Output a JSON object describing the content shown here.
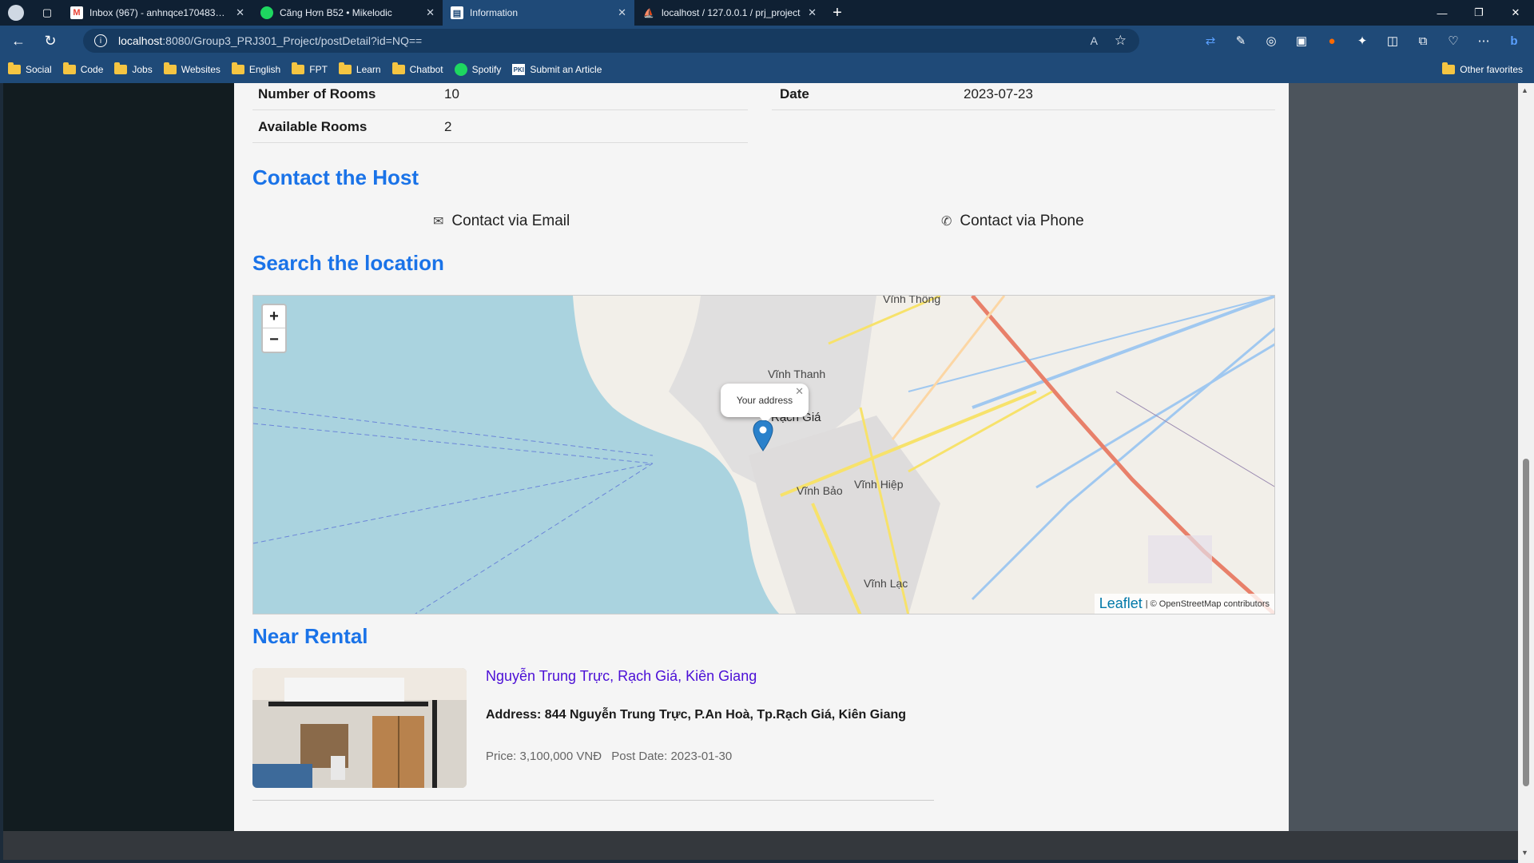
{
  "browser": {
    "tabs": [
      {
        "title": "Inbox (967) - anhnqce170483@fpt.edu.vn",
        "icon": "gmail-icon",
        "active": false
      },
      {
        "title": "Căng Hơn B52 • Mikelodic",
        "icon": "spotify-icon",
        "active": false
      },
      {
        "title": "Information",
        "icon": "page-icon",
        "active": true
      },
      {
        "title": "localhost / 127.0.0.1 / prj_project",
        "icon": "phpmyadmin-icon",
        "active": false
      }
    ],
    "url_host": "localhost",
    "url_path": ":8080/Group3_PRJ301_Project/postDetail?id=NQ==",
    "bookmarks": [
      "Social",
      "Code",
      "Jobs",
      "Websites",
      "English",
      "FPT",
      "Learn",
      "Chatbot",
      "Spotify",
      "Submit an Article"
    ],
    "other_favorites": "Other favorites"
  },
  "details": {
    "number_of_rooms_label": "Number of Rooms",
    "number_of_rooms": "10",
    "available_rooms_label": "Available Rooms",
    "available_rooms": "2",
    "date_label": "Date",
    "date": "2023-07-23"
  },
  "contact": {
    "heading": "Contact the Host",
    "email_label": "Contact via Email",
    "phone_label": "Contact via Phone"
  },
  "location": {
    "heading": "Search the location",
    "zoom_in": "+",
    "zoom_out": "−",
    "popup_text": "Your address",
    "attribution_leaflet": "Leaflet",
    "attribution_osm": "| © OpenStreetMap contributors",
    "labels": [
      "Rạch Giá",
      "Vĩnh Thanh",
      "Vĩnh Bảo",
      "Vĩnh Hiệp",
      "Vĩnh Lạc",
      "Vĩnh Thông"
    ]
  },
  "near_rental": {
    "heading": "Near Rental",
    "item": {
      "title": "Nguyễn Trung Trực, Rạch Giá, Kiên Giang",
      "address": "Address: 844 Nguyễn Trung Trực, P.An Hoà, Tp.Rạch Giá, Kiên Giang",
      "price": "Price: 3,100,000 VNĐ",
      "post_date": "Post Date: 2023-01-30"
    }
  },
  "colors": {
    "heading": "#1a73e8",
    "link": "#4b0fd6",
    "water": "#aad3df"
  }
}
